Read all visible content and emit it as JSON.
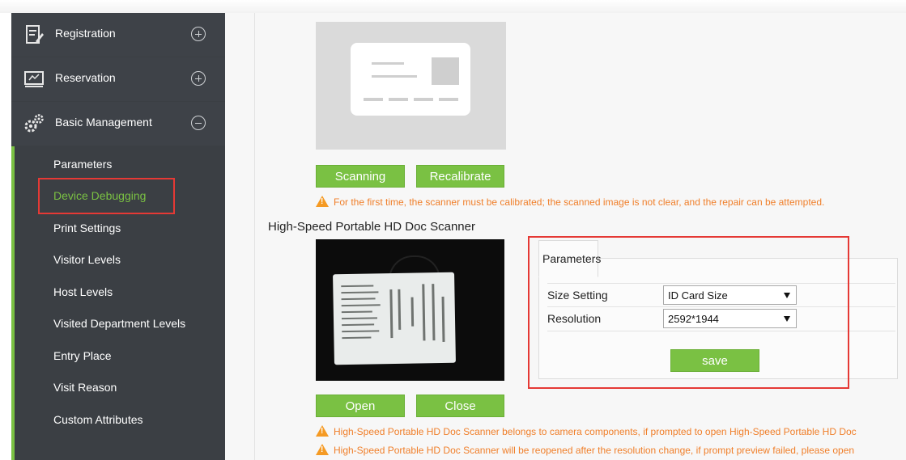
{
  "sidebar": {
    "menus": [
      {
        "label": "Registration",
        "icon": "registration-icon",
        "expanded": false
      },
      {
        "label": "Reservation",
        "icon": "reservation-icon",
        "expanded": false
      },
      {
        "label": "Basic Management",
        "icon": "gears-icon",
        "expanded": true
      }
    ],
    "items": [
      {
        "label": "Parameters"
      },
      {
        "label": "Device Debugging",
        "active": true
      },
      {
        "label": "Print Settings"
      },
      {
        "label": "Visitor Levels"
      },
      {
        "label": "Host Levels"
      },
      {
        "label": "Visited Department Levels"
      },
      {
        "label": "Entry Place"
      },
      {
        "label": "Visit Reason"
      },
      {
        "label": "Custom Attributes"
      }
    ]
  },
  "scanner": {
    "scanning_label": "Scanning",
    "recalibrate_label": "Recalibrate",
    "warning": "For the first time, the scanner must be calibrated; the scanned image is not clear, and the repair can be attempted."
  },
  "doc_scanner": {
    "title": "High-Speed Portable HD Doc Scanner",
    "open_label": "Open",
    "close_label": "Close",
    "warning1": "High-Speed Portable HD Doc Scanner belongs to camera components, if prompted to open High-Speed Portable HD Doc",
    "warning2": "High-Speed Portable HD Doc Scanner will be reopened after the resolution change, if prompt preview failed, please open"
  },
  "params": {
    "tab_label": "Parameters",
    "size_label": "Size Setting",
    "size_value": "ID Card Size",
    "resolution_label": "Resolution",
    "resolution_value": "2592*1944",
    "save_label": "save"
  },
  "colors": {
    "accent": "#7ac143",
    "warning": "#f07f2a",
    "highlight_box": "#e53935",
    "sidebar_bg": "#3b3f44"
  }
}
